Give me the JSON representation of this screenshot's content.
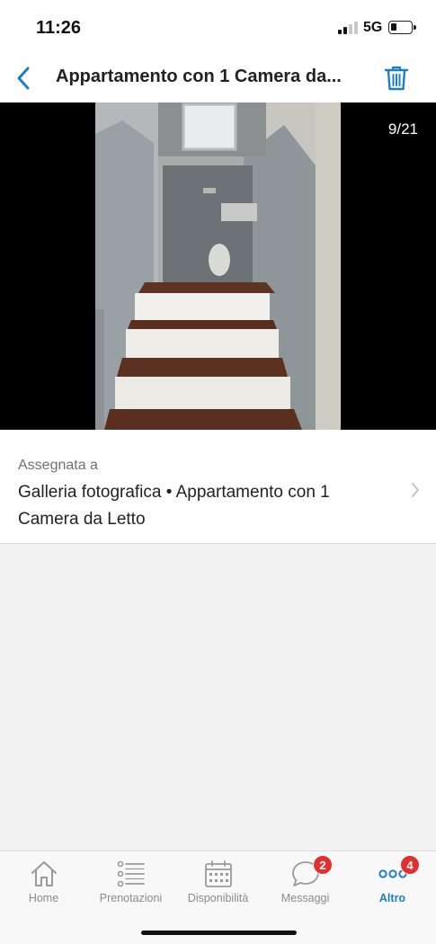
{
  "status_bar": {
    "time": "11:26",
    "network": "5G",
    "icons": [
      "signal-icon",
      "battery-icon"
    ]
  },
  "nav": {
    "title": "Appartamento con 1 Camera da...",
    "back_icon": "chevron-left-icon",
    "delete_icon": "trash-icon",
    "accent": "#1b7fc2"
  },
  "photo": {
    "counter": "9/21"
  },
  "assigned": {
    "label": "Assegnata a",
    "value": "Galleria fotografica • Appartamento con 1 Camera da Letto",
    "icon": "chevron-right-icon"
  },
  "tabs": [
    {
      "label": "Home",
      "icon": "home-icon",
      "badge": "",
      "active": false
    },
    {
      "label": "Prenotazioni",
      "icon": "list-icon",
      "badge": "",
      "active": false
    },
    {
      "label": "Disponibilità",
      "icon": "calendar-icon",
      "badge": "",
      "active": false
    },
    {
      "label": "Messaggi",
      "icon": "chat-bubble-icon",
      "badge": "2",
      "active": false
    },
    {
      "label": "Altro",
      "icon": "more-icon",
      "badge": "4",
      "active": true
    }
  ],
  "colors": {
    "accent": "#1b7fc2",
    "badge": "#e0302f"
  }
}
